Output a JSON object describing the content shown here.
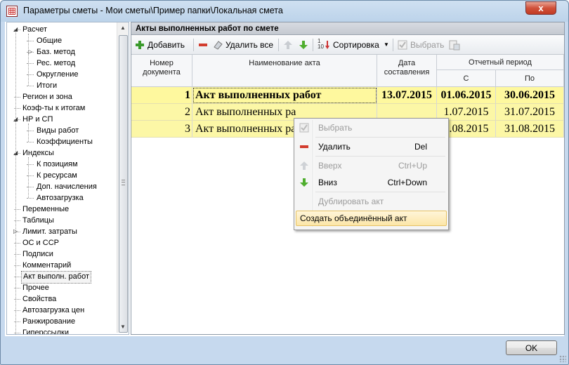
{
  "window": {
    "title": "Параметры сметы - Мои сметы\\Пример папки\\Локальная смета",
    "close_glyph": "x"
  },
  "tree": {
    "items": [
      {
        "label": "Расчет",
        "level": 0,
        "expander": "expanded"
      },
      {
        "label": "Общие",
        "level": 1,
        "expander": "none"
      },
      {
        "label": "Баз. метод",
        "level": 1,
        "expander": "collapsed"
      },
      {
        "label": "Рес. метод",
        "level": 1,
        "expander": "none"
      },
      {
        "label": "Округление",
        "level": 1,
        "expander": "none"
      },
      {
        "label": "Итоги",
        "level": 1,
        "expander": "none"
      },
      {
        "label": "Регион и зона",
        "level": 0,
        "expander": "none"
      },
      {
        "label": "Коэф-ты к итогам",
        "level": 0,
        "expander": "none"
      },
      {
        "label": "НР и СП",
        "level": 0,
        "expander": "expanded"
      },
      {
        "label": "Виды работ",
        "level": 1,
        "expander": "none"
      },
      {
        "label": "Коэффициенты",
        "level": 1,
        "expander": "none"
      },
      {
        "label": "Индексы",
        "level": 0,
        "expander": "expanded"
      },
      {
        "label": "К позициям",
        "level": 1,
        "expander": "none"
      },
      {
        "label": "К ресурсам",
        "level": 1,
        "expander": "none"
      },
      {
        "label": "Доп. начисления",
        "level": 1,
        "expander": "none"
      },
      {
        "label": "Автозагрузка",
        "level": 1,
        "expander": "none"
      },
      {
        "label": "Переменные",
        "level": 0,
        "expander": "none"
      },
      {
        "label": "Таблицы",
        "level": 0,
        "expander": "none"
      },
      {
        "label": "Лимит. затраты",
        "level": 0,
        "expander": "collapsed"
      },
      {
        "label": "ОС и ССР",
        "level": 0,
        "expander": "none"
      },
      {
        "label": "Подписи",
        "level": 0,
        "expander": "none"
      },
      {
        "label": "Комментарий",
        "level": 0,
        "expander": "none"
      },
      {
        "label": "Акт выполн. работ",
        "level": 0,
        "expander": "none",
        "selected": true
      },
      {
        "label": "Прочее",
        "level": 0,
        "expander": "none"
      },
      {
        "label": "Свойства",
        "level": 0,
        "expander": "none"
      },
      {
        "label": "Автозагрузка цен",
        "level": 0,
        "expander": "none"
      },
      {
        "label": "Ранжирование",
        "level": 0,
        "expander": "none"
      },
      {
        "label": "Гиперссылки",
        "level": 0,
        "expander": "none"
      }
    ]
  },
  "panel": {
    "header": "Акты выполненных работ по смете",
    "toolbar": {
      "add": "Добавить",
      "delete_all": "Удалить все",
      "sort": "Сортировка",
      "select": "Выбрать"
    }
  },
  "grid": {
    "headers": {
      "doc_number": "Номер документа",
      "act_name": "Наименование акта",
      "date": "Дата составления",
      "period": "Отчетный период",
      "period_from": "С",
      "period_to": "По"
    },
    "rows": [
      {
        "num": "1",
        "name": "Акт выполненных работ",
        "date": "13.07.2015",
        "from": "01.06.2015",
        "to": "30.06.2015",
        "bold": true
      },
      {
        "num": "2",
        "name": "Акт выполненных ра",
        "date": "",
        "from": "1.07.2015",
        "to": "31.07.2015",
        "bold": false
      },
      {
        "num": "3",
        "name": "Акт выполненных ра",
        "date": "",
        "from": "1.08.2015",
        "to": "31.08.2015",
        "bold": false
      }
    ],
    "row_color": "#fcf7a6",
    "row_selected_color": "#fef89e"
  },
  "context_menu": {
    "items": [
      {
        "label": "Выбрать",
        "shortcut": "",
        "disabled": true,
        "icon": "checkbox-icon"
      },
      {
        "label": "Удалить",
        "shortcut": "Del",
        "disabled": false,
        "icon": "red-minus-icon"
      },
      {
        "label": "Вверх",
        "shortcut": "Ctrl+Up",
        "disabled": true,
        "icon": "arrow-up-icon"
      },
      {
        "label": "Вниз",
        "shortcut": "Ctrl+Down",
        "disabled": false,
        "icon": "arrow-down-icon"
      },
      {
        "label": "Дублировать акт",
        "shortcut": "",
        "disabled": true,
        "icon": ""
      },
      {
        "label": "Создать объединённый акт",
        "shortcut": "",
        "disabled": false,
        "icon": "",
        "hover": true
      }
    ]
  },
  "footer": {
    "ok": "OK"
  }
}
